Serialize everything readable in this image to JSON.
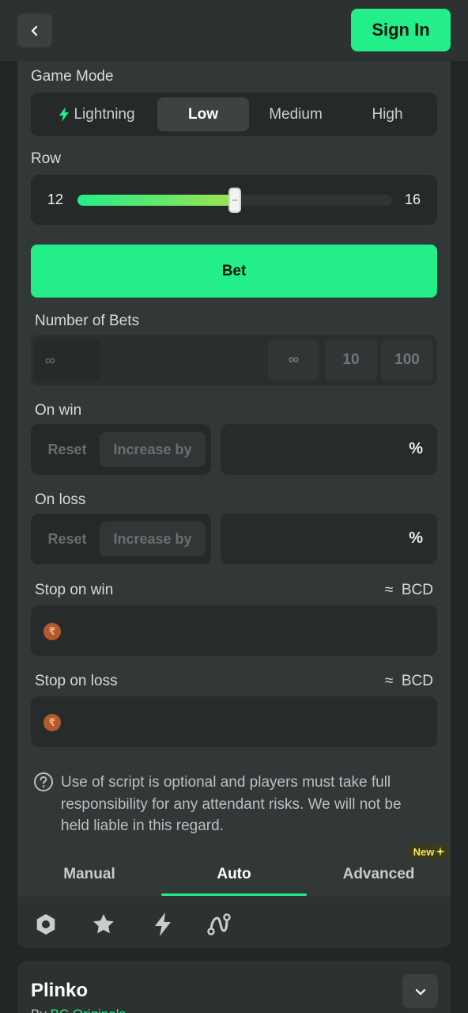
{
  "header": {
    "sign_in_label": "Sign In"
  },
  "game_mode": {
    "label": "Game Mode",
    "options": [
      "Lightning",
      "Low",
      "Medium",
      "High"
    ],
    "selected": "Low"
  },
  "row": {
    "label": "Row",
    "min": "12",
    "max": "16",
    "value_fraction": 0.5
  },
  "bet_button_label": "Bet",
  "number_of_bets": {
    "label": "Number of Bets",
    "value": "∞",
    "presets": [
      "∞",
      "10",
      "100"
    ]
  },
  "on_win": {
    "label": "On win",
    "options": [
      "Reset",
      "Increase by"
    ],
    "selected": "Increase by",
    "unit": "%"
  },
  "on_loss": {
    "label": "On loss",
    "options": [
      "Reset",
      "Increase by"
    ],
    "selected": "Increase by",
    "unit": "%"
  },
  "stop_on_win": {
    "label": "Stop on win",
    "currency": "≈  BCD",
    "coin_symbol": "₹"
  },
  "stop_on_loss": {
    "label": "Stop on loss",
    "currency": "≈  BCD",
    "coin_symbol": "₹"
  },
  "disclaimer": "Use of script is optional and players must take full responsibility for any attendant risks. We will not be held liable in this regard.",
  "tabs": {
    "items": [
      "Manual",
      "Auto",
      "Advanced"
    ],
    "active": "Auto",
    "new_badge": "New"
  },
  "toolbar_icons": [
    "hexagon-icon",
    "star-icon",
    "lightning-icon",
    "route-icon"
  ],
  "game_info": {
    "title": "Plinko",
    "by_prefix": "By",
    "provider": "BC Originals"
  },
  "colors": {
    "accent": "#24ee89",
    "background": "#232626",
    "panel": "#2d3131"
  }
}
